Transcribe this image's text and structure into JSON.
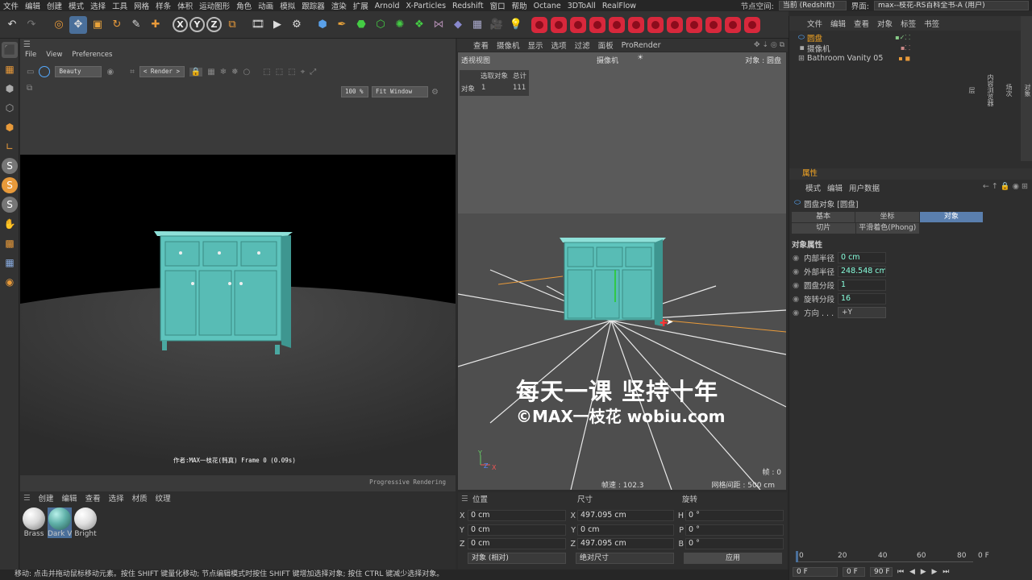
{
  "menu": [
    "文件",
    "编辑",
    "创建",
    "模式",
    "选择",
    "工具",
    "网格",
    "样条",
    "体积",
    "运动图形",
    "角色",
    "动画",
    "模拟",
    "跟踪器",
    "渲染",
    "扩展",
    "Arnold",
    "X-Particles",
    "Redshift",
    "窗口",
    "帮助",
    "Octane",
    "3DToAll",
    "RealFlow"
  ],
  "topright": {
    "nodespace_label": "节点空间:",
    "nodespace_value": "当前 (Redshift)",
    "layout_label": "界面:",
    "layout_value": "max--枝花-RS百科全书-A (用户)"
  },
  "left_toolbar_icons": [
    "cube-icon",
    "checker-icon",
    "cube-gray-icon",
    "box-icon",
    "box-orange-icon",
    "ruler-icon",
    "s-icon",
    "s-orange-icon",
    "s-icon",
    "brush-icon",
    "grid-icon",
    "grid-blue-icon",
    "target-icon"
  ],
  "renderview": {
    "menu": [
      "File",
      "View",
      "Preferences"
    ],
    "pass": "Beauty",
    "aov": "< Render >",
    "zoom": "100 %",
    "fit": "Fit Window",
    "caption": "作者:MAX一枝花(韩真)  Frame  0 (0.09s)",
    "status": "Progressive Rendering"
  },
  "viewport": {
    "menu": [
      "查看",
      "摄像机",
      "显示",
      "选项",
      "过滤",
      "面板",
      "ProRender"
    ],
    "title": "透视视图",
    "camera": "摄像机",
    "object_label": "对象 : 圆盘",
    "stats_header": [
      "选取对象",
      "总计"
    ],
    "stats_row": [
      "对象",
      "1",
      "111"
    ],
    "fps": "帧速 : 102.3",
    "grid": "网格间距 : 500 cm",
    "frame": "帧 : 0",
    "watermark_line1": "每天一课 坚持十年",
    "watermark_line2": "©MAX一枝花 wobiu.com"
  },
  "objects": {
    "menu": [
      "文件",
      "编辑",
      "查看",
      "对象",
      "标签",
      "书签"
    ],
    "items": [
      {
        "name": "圆盘",
        "selected": true
      },
      {
        "name": "摄像机",
        "selected": false
      },
      {
        "name": "Bathroom Vanity 05",
        "selected": false
      }
    ],
    "side_tabs": [
      "对象",
      "场次",
      "内容浏览器",
      "层"
    ]
  },
  "attributes": {
    "title": "属性",
    "menu": [
      "模式",
      "编辑",
      "用户数据"
    ],
    "object": "圆盘对象 [圆盘]",
    "tabs": [
      "基本",
      "坐标",
      "对象",
      "切片",
      "平滑着色(Phong)"
    ],
    "active_tab": "对象",
    "section": "对象属性",
    "fields": [
      {
        "label": "内部半径",
        "value": "0 cm"
      },
      {
        "label": "外部半径",
        "value": "248.548 cm"
      },
      {
        "label": "圆盘分段",
        "value": "1"
      },
      {
        "label": "旋转分段",
        "value": "16"
      },
      {
        "label": "方向 . . . .",
        "value": "+Y"
      }
    ]
  },
  "materials": {
    "menu": [
      "创建",
      "编辑",
      "查看",
      "选择",
      "材质",
      "纹理"
    ],
    "items": [
      {
        "name": "Brass",
        "color": "#d8d8d8"
      },
      {
        "name": "Dark V",
        "color": "#5fb0a8"
      },
      {
        "name": "Bright",
        "color": "#e0e0e0"
      }
    ]
  },
  "coords": {
    "headers": [
      "位置",
      "尺寸",
      "旋转"
    ],
    "rows": [
      {
        "pos_axis": "X",
        "pos": "0 cm",
        "size_axis": "X",
        "size": "497.095 cm",
        "rot_axis": "H",
        "rot": "0 °"
      },
      {
        "pos_axis": "Y",
        "pos": "0 cm",
        "size_axis": "Y",
        "size": "0 cm",
        "rot_axis": "P",
        "rot": "0 °"
      },
      {
        "pos_axis": "Z",
        "pos": "0 cm",
        "size_axis": "Z",
        "size": "497.095 cm",
        "rot_axis": "B",
        "rot": "0 °"
      }
    ],
    "mode": "对象 (相对)",
    "sizemode": "绝对尺寸",
    "apply": "应用"
  },
  "timeline": {
    "ticks": [
      "0",
      "20",
      "40",
      "60",
      "80"
    ],
    "current": "0 F",
    "start": "0 F",
    "min": "0 F",
    "end": "90 F"
  },
  "statusbar": "移动: 点击并拖动鼠标移动元素。按住 SHIFT 键量化移动; 节点编辑模式时按住 SHIFT 键增加选择对象; 按住 CTRL 键减少选择对象。",
  "colors": {
    "accent": "#4a6f9a",
    "cabinet": "#5ec4bd",
    "red_tool": "#d8283c"
  }
}
